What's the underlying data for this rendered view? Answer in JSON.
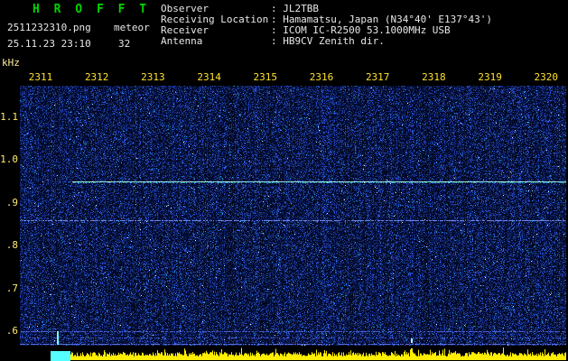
{
  "header": {
    "app_title": "H R O F F T",
    "filename": "2511232310.png",
    "mode_label": "meteor",
    "datetime": "25.11.23 23:10",
    "count": "32",
    "info_fields": [
      {
        "label": "Observer",
        "value": ": JL2TBB"
      },
      {
        "label": "Receiving Location",
        "value": ": Hamamatsu, Japan (N34°40' E137°43')"
      },
      {
        "label": "Receiver",
        "value": ": ICOM IC-R2500 53.1000MHz USB"
      },
      {
        "label": "Antenna",
        "value": ": HB9CV Zenith dir."
      }
    ]
  },
  "colors": {
    "title_green": "#00d400",
    "header_text": "#e8e8e8",
    "time_label_yellow": "#ffe12f",
    "freq_label_yellow": "#ffe96a",
    "background": "#000000",
    "noise_base_blue": "#000030",
    "carrier_cyan_green": "#9fffc8",
    "amplitude_yellow": "#ffee00",
    "calibration_cyan": "#55ffff"
  },
  "chart_data": {
    "type": "heatmap",
    "title": "",
    "xlabel": "",
    "ylabel": "kHz",
    "x_ticks": [
      "2311",
      "2312",
      "2313",
      "2314",
      "2315",
      "2316",
      "2317",
      "2318",
      "2319",
      "2320"
    ],
    "y_ticks": [
      "1.1",
      "1.0",
      ".9",
      ".8",
      ".7",
      ".6"
    ],
    "ylim": [
      0.55,
      1.17
    ],
    "grid": false,
    "legend": "none",
    "background_style": "dark-blue radio noise speckle",
    "noise_seed": 20251123,
    "signals": [
      {
        "name": "carrier-line-0.95kHz",
        "freq_khz": 0.95,
        "start_frac": 0.096,
        "end_frac": 1.0,
        "intensity": "strong",
        "color": "#9fffc8"
      },
      {
        "name": "weak-line-0.86kHz",
        "freq_khz": 0.86,
        "start_frac": 0.0,
        "end_frac": 1.0,
        "intensity": "weak",
        "color": "#6f86e8"
      },
      {
        "name": "weak-line-0.60kHz",
        "freq_khz": 0.6,
        "start_frac": 0.0,
        "end_frac": 1.0,
        "intensity": "weak",
        "color": "#4a5fd0"
      },
      {
        "name": "faint-line-0.585kHz",
        "freq_khz": 0.585,
        "start_frac": 0.0,
        "end_frac": 1.0,
        "intensity": "faint",
        "color": "#4456c8"
      },
      {
        "name": "edge-line-0.57kHz",
        "freq_khz": 0.57,
        "start_frac": 0.0,
        "end_frac": 1.0,
        "intensity": "weak",
        "color": "#5a6ede"
      }
    ],
    "calibration_mark": {
      "x_frac": 0.068,
      "freq_khz_from": 0.57,
      "freq_khz_to": 0.6,
      "color": "#7dfff0"
    },
    "echo_marks": [
      {
        "x_frac": 0.716,
        "freq_khz": 0.578,
        "color": "#aaeeff"
      }
    ],
    "amplitude": {
      "color": "#ffee00",
      "calibration_color": "#55ffff",
      "start_frac": 0.056,
      "spike_x_frac": 0.716
    }
  }
}
